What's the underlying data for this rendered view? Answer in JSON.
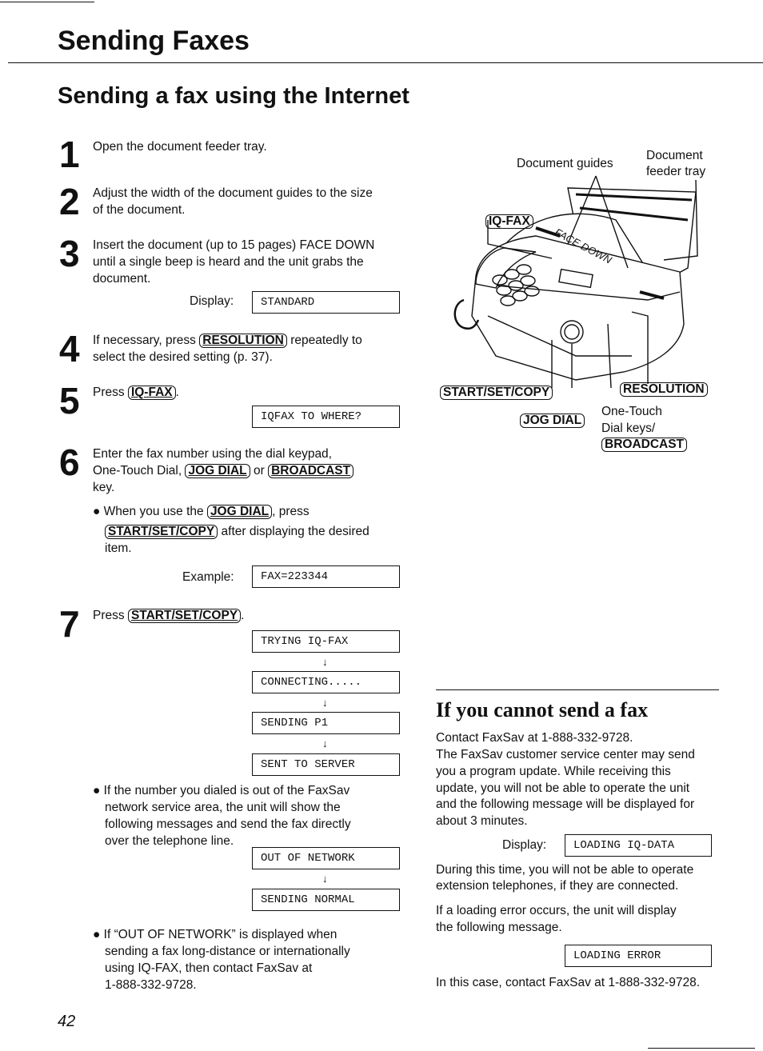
{
  "header": {
    "title": "Sending Faxes",
    "subtitle": "Sending a fax using the Internet"
  },
  "steps": {
    "s1": {
      "num": "1",
      "l1": "Open the document feeder tray."
    },
    "s2": {
      "num": "2",
      "l1": "Adjust the width of the document guides to the size",
      "l2": "of the document."
    },
    "s3": {
      "num": "3",
      "l1": "Insert the document (up to 15 pages) FACE DOWN",
      "l2": "until a single beep is heard and the unit grabs the",
      "l3": "document.",
      "display_label": "Display:",
      "display": "STANDARD"
    },
    "s4": {
      "num": "4",
      "l1a": "If necessary, press",
      "key": "RESOLUTION",
      "l1b": "repeatedly to",
      "l2": "select the desired setting (p. 37)."
    },
    "s5": {
      "num": "5",
      "l1a": "Press",
      "key": "IQ-FAX",
      "l1b": ".",
      "display": "IQFAX TO WHERE?"
    },
    "s6": {
      "num": "6",
      "l1": "Enter the fax number using the dial keypad,",
      "l2a": "One-Touch Dial,",
      "key1": "JOG DIAL",
      "l2b": "or",
      "key2": "BROADCAST",
      "l3": "key.",
      "b1a": "When you use the",
      "bkey1": "JOG DIAL",
      "b1b": ", press",
      "bkey2": "START/SET/COPY",
      "b2b": "after displaying the desired",
      "b3": "item.",
      "example_label": "Example:",
      "example": "FAX=223344"
    },
    "s7": {
      "num": "7",
      "l1a": "Press",
      "key": "START/SET/COPY",
      "l1b": ".",
      "displays": [
        "TRYING IQ-FAX",
        "CONNECTING.....",
        "SENDING P1",
        "SENT TO SERVER"
      ],
      "note1": [
        "If the number you dialed is out of the FaxSav",
        "network service area, the unit will show the",
        "following messages and send the fax directly",
        "over the telephone line."
      ],
      "displays2": [
        "OUT OF NETWORK",
        "SENDING NORMAL"
      ],
      "note2": [
        "If “OUT OF NETWORK” is displayed when",
        "sending a fax long-distance or internationally",
        "using IQ-FAX, then contact FaxSav at",
        "1-888-332-9728."
      ]
    }
  },
  "figure": {
    "doc_guides": "Document guides",
    "feeder_tray_l1": "Document",
    "feeder_tray_l2": "feeder tray",
    "iqfax": "IQ-FAX",
    "start": "START/SET/COPY",
    "resolution": "RESOLUTION",
    "jog": "JOG DIAL",
    "onetouch_l1": "One-Touch",
    "onetouch_l2": "Dial keys/",
    "broadcast": "BROADCAST",
    "face_down": "FACE DOWN"
  },
  "cannot": {
    "title": "If you cannot send a fax",
    "p1": [
      "Contact FaxSav at 1-888-332-9728.",
      "The FaxSav customer service center may send",
      "you a program update. While receiving this",
      "update, you will not be able to operate the unit",
      "and the following message will be displayed for",
      "about 3 minutes."
    ],
    "display_label": "Display:",
    "display": "LOADING IQ-DATA",
    "p2": [
      "During this time, you will not be able to operate",
      "extension telephones, if they are connected."
    ],
    "p3": [
      "If a loading error occurs, the unit will display",
      "the following message."
    ],
    "display2": "LOADING ERROR",
    "p4": "In this case, contact FaxSav at 1-888-332-9728."
  },
  "page_number": "42"
}
